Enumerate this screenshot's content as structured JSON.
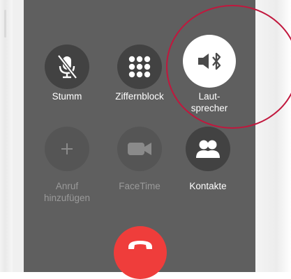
{
  "call_controls": {
    "row1": [
      {
        "label": "Stumm",
        "icon": "mute-microphone-icon",
        "state": "normal"
      },
      {
        "label": "Ziffernblock",
        "icon": "keypad-icon",
        "state": "normal"
      },
      {
        "label": "Laut-\nsprecher",
        "icon": "bluetooth-speaker-icon",
        "state": "active"
      }
    ],
    "row2": [
      {
        "label": "Anruf\nhinzufügen",
        "icon": "plus-icon",
        "state": "disabled"
      },
      {
        "label": "FaceTime",
        "icon": "video-camera-icon",
        "state": "disabled"
      },
      {
        "label": "Kontakte",
        "icon": "contacts-icon",
        "state": "normal"
      }
    ]
  },
  "end_call": {
    "icon": "phone-hang-up-icon",
    "color": "#ef3d3b"
  },
  "annotation": {
    "shape": "circle",
    "color": "#c1173d",
    "target": "speaker-button"
  }
}
